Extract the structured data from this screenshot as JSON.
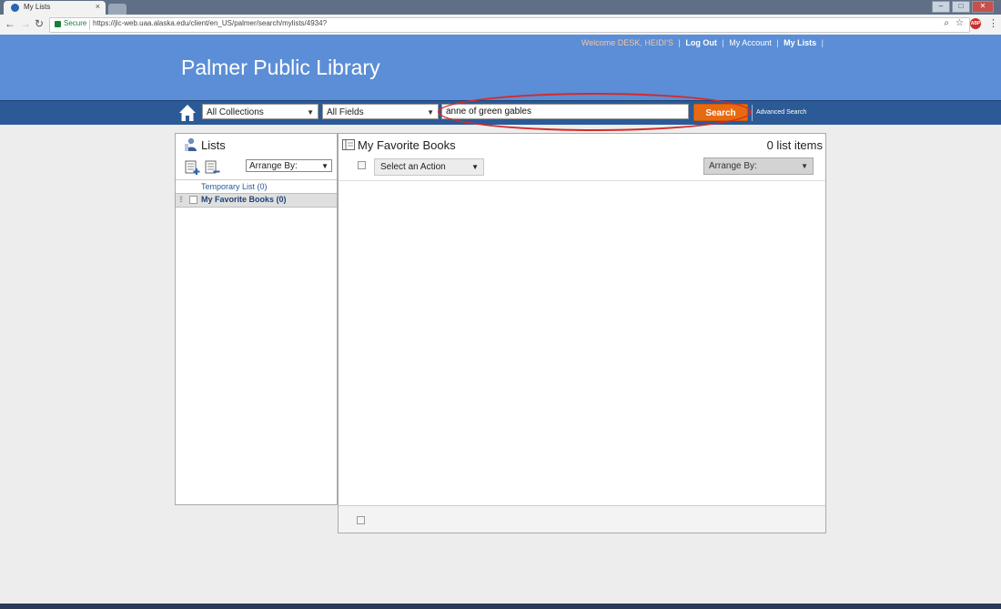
{
  "browser": {
    "tab_title": "My Lists",
    "tab_close": "×",
    "secure_label": "Secure",
    "url": "https://jlc-web.uaa.alaska.edu/client/en_US/palmer/search/mylists/4934?",
    "extension_badge": "ABP"
  },
  "header": {
    "welcome": "Welcome DESK, HEIDI'S",
    "links": [
      "Log Out",
      "My Account",
      "My Lists"
    ],
    "library_name": "Palmer Public Library"
  },
  "search": {
    "collection": "All Collections",
    "field": "All Fields",
    "query": "anne of green gables",
    "button": "Search",
    "advanced": "Advanced Search",
    "button_color": "#e86a10",
    "annotation_color": "#d42a2a"
  },
  "lists_panel": {
    "title": "Lists",
    "arrange_label": "Arrange By:",
    "items": [
      {
        "label": "Temporary List (0)"
      },
      {
        "label": "My Favorite Books (0)"
      }
    ]
  },
  "main_panel": {
    "title": "My Favorite Books",
    "count": "0 list items",
    "action_label": "Select an Action",
    "arrange_label": "Arrange By:"
  },
  "colors": {
    "header_blue": "#5b8ed6",
    "searchbar_blue": "#2b5a97"
  }
}
